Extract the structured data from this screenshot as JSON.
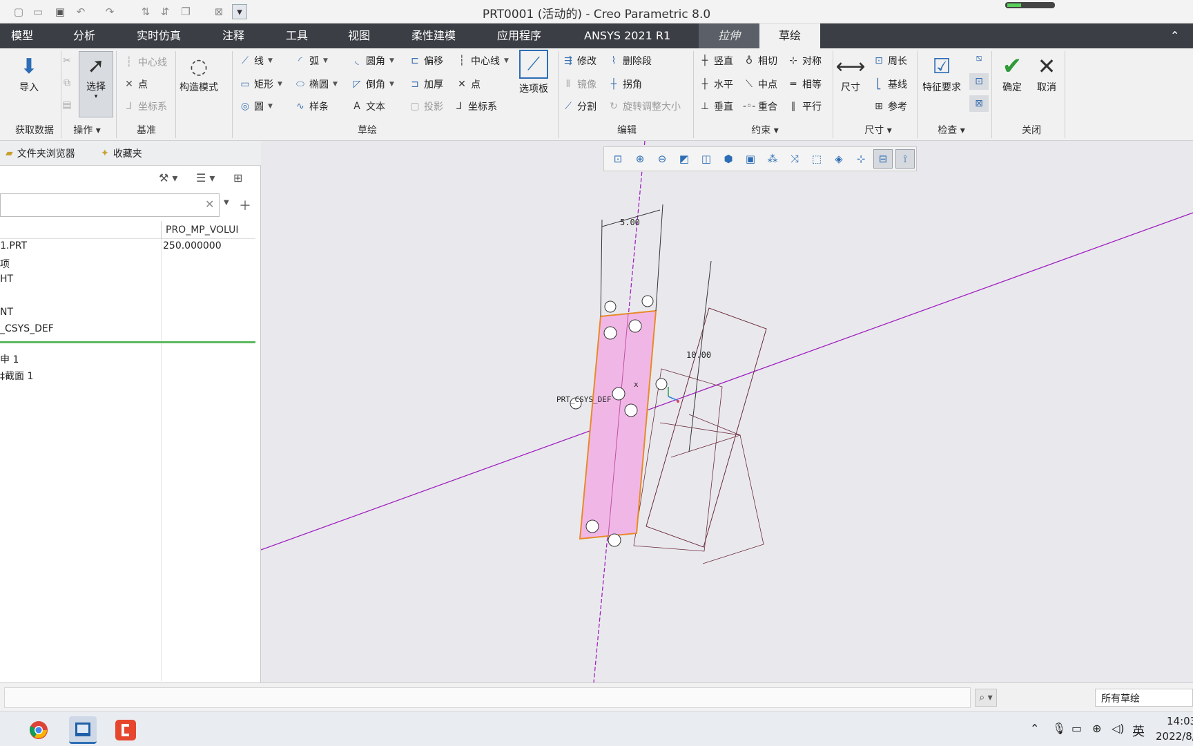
{
  "window": {
    "title": "PRT0001 (活动的) - Creo Parametric 8.0"
  },
  "menu": {
    "tabs": [
      "模型",
      "分析",
      "实时仿真",
      "注释",
      "工具",
      "视图",
      "柔性建模",
      "应用程序",
      "ANSYS 2021 R1",
      "拉伸",
      "草绘"
    ]
  },
  "ribbon": {
    "get_data": {
      "import": "导入",
      "label": "获取数据"
    },
    "operations": {
      "select": "选择",
      "label": "操作"
    },
    "datum": {
      "centerline": "中心线",
      "point": "点",
      "csys": "坐标系",
      "label": "基准"
    },
    "construction": {
      "mode": "构造模式"
    },
    "sketch": {
      "line": "线",
      "arc": "弧",
      "fillet": "圆角",
      "offset": "偏移",
      "centerline": "中心线",
      "rectangle": "矩形",
      "ellipse": "椭圆",
      "chamfer": "倒角",
      "thicken": "加厚",
      "point": "点",
      "circle": "圆",
      "spline": "样条",
      "text": "文本",
      "project": "投影",
      "csys": "坐标系",
      "palette": "选项板",
      "label": "草绘"
    },
    "edit": {
      "modify": "修改",
      "delete_segment": "删除段",
      "mirror": "镜像",
      "corner": "拐角",
      "divide": "分割",
      "rotate_resize": "旋转调整大小",
      "label": "编辑"
    },
    "constrain": {
      "vertical": "竖直",
      "tangent": "相切",
      "symmetric": "对称",
      "horizontal": "水平",
      "midpoint": "中点",
      "equal": "相等",
      "perpendicular": "垂直",
      "coincident": "重合",
      "parallel": "平行",
      "label": "约束"
    },
    "dimension": {
      "dimension": "尺寸",
      "perimeter": "周长",
      "baseline": "基线",
      "reference": "参考",
      "label": "尺寸"
    },
    "inspect": {
      "feature_requirements": "特征要求",
      "label": "检查"
    },
    "close": {
      "ok": "确定",
      "cancel": "取消",
      "label": "关闭"
    }
  },
  "navigator": {
    "tabs": {
      "folder_browser": "文件夹浏览器",
      "favorites": "收藏夹"
    },
    "column": "PRO_MP_VOLUI",
    "rows": [
      {
        "label": "1.PRT",
        "value": "250.000000"
      },
      {
        "label": "项",
        "value": ""
      },
      {
        "label": "HT",
        "value": ""
      },
      {
        "label": "NT",
        "value": ""
      },
      {
        "label": "_CSYS_DEF",
        "value": ""
      },
      {
        "label": "申 1",
        "value": ""
      },
      {
        "label": "‡截面 1",
        "value": ""
      }
    ]
  },
  "canvas": {
    "dim_width": "5.00",
    "dim_height": "10.00",
    "csys_label": "PRT_CSYS_DEF",
    "axis_label": "x",
    "colors": {
      "sketch_fill": "#f0b7e6",
      "sketch_edge": "#e8892a",
      "datum_line": "#a020c0"
    }
  },
  "status": {
    "filter": "所有草绘"
  },
  "taskbar": {
    "ime": "英",
    "time": "14:03",
    "date": "2022/8/"
  }
}
